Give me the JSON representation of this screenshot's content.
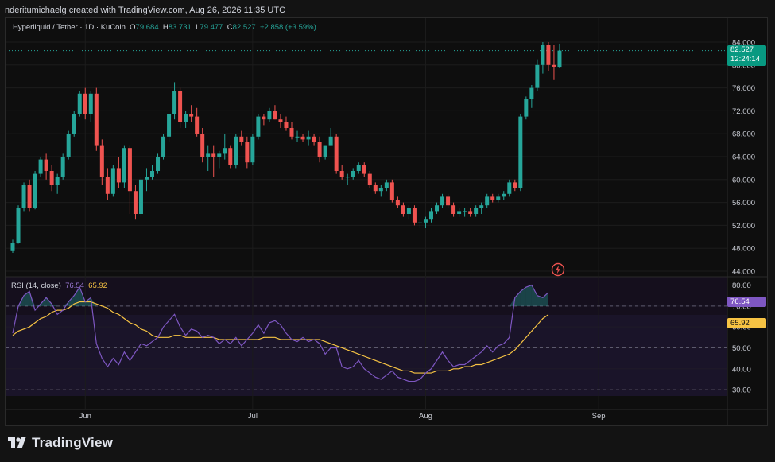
{
  "caption": "nderitumichaelg created with TradingView.com, Aug 26, 2026 11:35 UTC",
  "legend": {
    "symbol": "Hyperliquid / Tether · 1D · KuCoin",
    "o_label": "O",
    "o_val": "79.684",
    "h_label": "H",
    "h_val": "83.731",
    "l_label": "L",
    "l_val": "79.477",
    "c_label": "C",
    "c_val": "82.527",
    "change": "+2.858 (+3.59%)"
  },
  "rsi_legend": {
    "name": "RSI (14, close)",
    "rsi": "76.54",
    "ma": "65.92"
  },
  "price_tag": {
    "price": "82.527",
    "countdown": "12:24:14"
  },
  "rsi_tag": "76.54",
  "ma_tag": "65.92",
  "logo_text": "TradingView",
  "colors": {
    "up": "#26a69a",
    "down": "#ef5350",
    "rsi": "#7e57c2",
    "ma": "#f6c343",
    "price_tag": "#089981"
  },
  "chart_data": [
    {
      "type": "candlestick",
      "ylim": [
        44,
        86
      ],
      "price_ticks": [
        "84.000",
        "80.000",
        "76.000",
        "72.000",
        "68.000",
        "64.000",
        "60.000",
        "56.000",
        "52.000",
        "48.000",
        "44.000"
      ],
      "x_ticks": [
        {
          "label": "Jun",
          "index": 13
        },
        {
          "label": "Jul",
          "index": 43
        },
        {
          "label": "Aug",
          "index": 74
        },
        {
          "label": "Sep",
          "index": 105
        }
      ],
      "last_price_line": 82.527,
      "candles": [
        [
          47.5,
          49.5,
          47.2,
          49.0
        ],
        [
          49.0,
          55.5,
          48.8,
          55.0
        ],
        [
          55.0,
          59.5,
          54.5,
          59.0
        ],
        [
          59.0,
          60.0,
          54.5,
          55.0
        ],
        [
          55.0,
          61.5,
          54.8,
          61.0
        ],
        [
          61.0,
          64.0,
          60.5,
          63.5
        ],
        [
          63.5,
          64.5,
          60.0,
          61.5
        ],
        [
          61.5,
          62.5,
          58.0,
          59.0
        ],
        [
          59.0,
          61.0,
          57.5,
          60.5
        ],
        [
          60.5,
          64.5,
          60.0,
          64.0
        ],
        [
          64.0,
          68.5,
          63.5,
          68.0
        ],
        [
          68.0,
          72.0,
          67.5,
          71.5
        ],
        [
          71.5,
          75.5,
          71.0,
          75.0
        ],
        [
          75.0,
          76.0,
          70.5,
          71.5
        ],
        [
          71.5,
          75.5,
          70.0,
          75.0
        ],
        [
          75.0,
          76.0,
          65.0,
          66.0
        ],
        [
          66.0,
          67.0,
          59.0,
          60.5
        ],
        [
          60.5,
          62.0,
          56.5,
          57.5
        ],
        [
          57.5,
          62.5,
          57.0,
          62.0
        ],
        [
          62.0,
          64.0,
          58.5,
          59.5
        ],
        [
          59.5,
          66.0,
          58.5,
          65.5
        ],
        [
          65.5,
          66.0,
          54.0,
          58.0
        ],
        [
          58.0,
          59.0,
          53.0,
          54.0
        ],
        [
          54.0,
          60.5,
          53.5,
          60.0
        ],
        [
          60.0,
          62.0,
          58.0,
          60.5
        ],
        [
          60.5,
          62.5,
          60.0,
          61.5
        ],
        [
          61.5,
          64.5,
          61.0,
          64.0
        ],
        [
          64.0,
          68.0,
          63.5,
          67.5
        ],
        [
          67.5,
          71.5,
          66.5,
          71.5
        ],
        [
          71.5,
          77.0,
          70.5,
          75.5
        ],
        [
          75.5,
          76.0,
          69.0,
          70.0
        ],
        [
          70.0,
          72.0,
          69.0,
          71.5
        ],
        [
          71.5,
          73.0,
          70.0,
          71.0
        ],
        [
          71.0,
          72.5,
          67.5,
          68.0
        ],
        [
          68.0,
          69.0,
          63.0,
          64.0
        ],
        [
          64.0,
          66.0,
          61.5,
          64.5
        ],
        [
          64.5,
          66.0,
          60.5,
          64.0
        ],
        [
          64.0,
          65.0,
          62.0,
          64.5
        ],
        [
          64.5,
          68.0,
          63.5,
          65.5
        ],
        [
          65.5,
          66.0,
          62.0,
          62.5
        ],
        [
          62.5,
          68.0,
          62.0,
          67.5
        ],
        [
          67.5,
          68.5,
          66.0,
          66.5
        ],
        [
          66.5,
          67.5,
          62.0,
          63.0
        ],
        [
          63.0,
          68.0,
          62.5,
          67.5
        ],
        [
          67.5,
          71.5,
          67.0,
          71.0
        ],
        [
          71.0,
          71.5,
          69.5,
          70.5
        ],
        [
          70.5,
          72.5,
          70.0,
          72.0
        ],
        [
          72.0,
          73.0,
          70.5,
          70.5
        ],
        [
          70.5,
          71.5,
          69.0,
          70.0
        ],
        [
          70.0,
          71.0,
          68.5,
          69.0
        ],
        [
          69.0,
          70.0,
          67.0,
          67.5
        ],
        [
          67.5,
          68.5,
          66.5,
          67.5
        ],
        [
          67.5,
          68.0,
          66.5,
          67.0
        ],
        [
          67.0,
          68.5,
          66.0,
          67.5
        ],
        [
          67.5,
          68.0,
          66.0,
          66.5
        ],
        [
          66.5,
          67.5,
          63.0,
          64.0
        ],
        [
          64.0,
          66.0,
          63.5,
          66.0
        ],
        [
          66.0,
          69.0,
          66.0,
          67.5
        ],
        [
          67.5,
          68.0,
          61.0,
          61.5
        ],
        [
          61.5,
          62.5,
          60.0,
          60.5
        ],
        [
          60.5,
          61.0,
          59.0,
          60.5
        ],
        [
          60.5,
          62.0,
          60.0,
          61.5
        ],
        [
          61.5,
          63.0,
          61.0,
          62.5
        ],
        [
          62.5,
          63.0,
          60.5,
          61.0
        ],
        [
          61.0,
          61.5,
          58.5,
          59.0
        ],
        [
          59.0,
          59.5,
          57.5,
          58.0
        ],
        [
          58.0,
          59.0,
          57.0,
          58.5
        ],
        [
          58.5,
          60.0,
          58.0,
          59.5
        ],
        [
          59.5,
          60.0,
          56.0,
          56.5
        ],
        [
          56.5,
          57.0,
          55.0,
          55.5
        ],
        [
          55.5,
          56.0,
          53.5,
          54.0
        ],
        [
          54.0,
          55.5,
          53.0,
          55.0
        ],
        [
          55.0,
          55.5,
          52.0,
          52.5
        ],
        [
          52.5,
          53.0,
          51.5,
          52.5
        ],
        [
          52.5,
          53.5,
          51.5,
          53.0
        ],
        [
          53.0,
          55.0,
          52.5,
          54.5
        ],
        [
          54.5,
          56.0,
          54.0,
          55.5
        ],
        [
          55.5,
          57.5,
          55.0,
          57.0
        ],
        [
          57.0,
          57.5,
          55.0,
          55.5
        ],
        [
          55.5,
          56.0,
          53.5,
          54.0
        ],
        [
          54.0,
          55.0,
          53.5,
          54.5
        ],
        [
          54.5,
          55.0,
          53.5,
          54.5
        ],
        [
          54.5,
          55.0,
          53.5,
          54.0
        ],
        [
          54.0,
          55.5,
          53.5,
          55.0
        ],
        [
          55.0,
          56.0,
          54.0,
          55.5
        ],
        [
          55.5,
          57.5,
          55.0,
          57.0
        ],
        [
          57.0,
          57.5,
          56.0,
          56.5
        ],
        [
          56.5,
          57.5,
          56.0,
          57.0
        ],
        [
          57.0,
          58.0,
          56.5,
          57.5
        ],
        [
          57.5,
          60.0,
          57.0,
          59.5
        ],
        [
          59.5,
          60.0,
          58.0,
          58.5
        ],
        [
          58.5,
          71.5,
          58.0,
          71.0
        ],
        [
          71.0,
          74.5,
          70.5,
          74.0
        ],
        [
          74.0,
          76.5,
          72.5,
          76.0
        ],
        [
          76.0,
          81.0,
          75.5,
          80.0
        ],
        [
          80.0,
          84.0,
          78.5,
          83.5
        ],
        [
          83.5,
          84.0,
          79.0,
          80.0
        ],
        [
          80.0,
          83.5,
          77.5,
          79.7
        ],
        [
          79.684,
          83.731,
          79.477,
          82.527
        ]
      ]
    },
    {
      "type": "line",
      "title": "RSI (14, close)",
      "ylim": [
        27,
        84
      ],
      "y_ticks": [
        "80.00",
        "70.00",
        "60.00",
        "50.00",
        "40.00",
        "30.00"
      ],
      "bands": {
        "upper": 70,
        "middle": 50,
        "lower": 30
      },
      "series": [
        {
          "name": "RSI",
          "values": [
            57,
            70,
            75,
            77,
            68,
            71,
            74,
            71,
            66,
            68,
            72,
            75,
            79,
            72,
            74,
            52,
            45,
            41,
            45,
            42,
            48,
            44,
            48,
            52,
            51,
            53,
            55,
            60,
            63,
            66,
            60,
            56,
            59,
            58,
            55,
            56,
            55,
            52,
            54,
            52,
            55,
            51,
            54,
            57,
            61,
            57,
            62,
            63,
            61,
            57,
            54,
            53,
            55,
            53,
            54,
            52,
            47,
            50,
            50,
            41,
            40,
            41,
            44,
            40,
            38,
            36,
            35,
            37,
            39,
            36,
            35,
            34,
            34,
            35,
            38,
            40,
            44,
            48,
            44,
            41,
            42,
            42,
            44,
            46,
            48,
            51,
            48,
            51,
            52,
            55,
            74,
            77,
            79,
            80,
            75,
            74,
            76.54
          ]
        },
        {
          "name": "RSI-based MA",
          "values": [
            56,
            58,
            59,
            60,
            62,
            64,
            65,
            67,
            68,
            68,
            69,
            71,
            72,
            72,
            72,
            71,
            70,
            69,
            67,
            66,
            64,
            62,
            61,
            59,
            58,
            56,
            55,
            55,
            55,
            56,
            56,
            55,
            55,
            55,
            55,
            55,
            55,
            54,
            54,
            54,
            54,
            54,
            54,
            54,
            54,
            55,
            55,
            55,
            54,
            54,
            54,
            54,
            54,
            54,
            54,
            54,
            53,
            52,
            51,
            50,
            49,
            48,
            47,
            46,
            45,
            44,
            43,
            42,
            41,
            40,
            39,
            39,
            38,
            38,
            38,
            38,
            39,
            39,
            39,
            40,
            40,
            41,
            41,
            42,
            42,
            43,
            44,
            45,
            46,
            47,
            49,
            52,
            55,
            58,
            61,
            64,
            65.92
          ]
        }
      ]
    }
  ]
}
